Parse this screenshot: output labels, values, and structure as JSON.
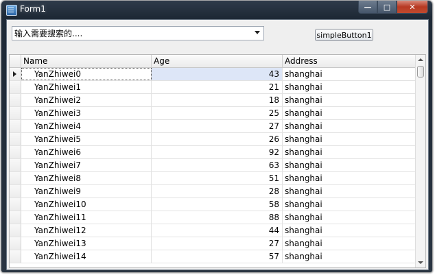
{
  "window": {
    "title": "Form1",
    "icon": "app-form-icon",
    "controls": [
      "minimize-icon",
      "maximize-icon",
      "close-icon"
    ]
  },
  "search": {
    "value": "输入需要搜索的....",
    "icon": "chevron-down-icon"
  },
  "button": {
    "label": "simpleButton1"
  },
  "grid": {
    "columns": [
      "Name",
      "Age",
      "Address"
    ],
    "rows": [
      {
        "name": "YanZhiwei0",
        "age": "43",
        "address": "shanghai"
      },
      {
        "name": "YanZhiwei1",
        "age": "21",
        "address": "shanghai"
      },
      {
        "name": "YanZhiwei2",
        "age": "18",
        "address": "shanghai"
      },
      {
        "name": "YanZhiwei3",
        "age": "25",
        "address": "shanghai"
      },
      {
        "name": "YanZhiwei4",
        "age": "27",
        "address": "shanghai"
      },
      {
        "name": "YanZhiwei5",
        "age": "26",
        "address": "shanghai"
      },
      {
        "name": "YanZhiwei6",
        "age": "92",
        "address": "shanghai"
      },
      {
        "name": "YanZhiwei7",
        "age": "63",
        "address": "shanghai"
      },
      {
        "name": "YanZhiwei8",
        "age": "51",
        "address": "shanghai"
      },
      {
        "name": "YanZhiwei9",
        "age": "28",
        "address": "shanghai"
      },
      {
        "name": "YanZhiwei10",
        "age": "58",
        "address": "shanghai"
      },
      {
        "name": "YanZhiwei11",
        "age": "88",
        "address": "shanghai"
      },
      {
        "name": "YanZhiwei12",
        "age": "44",
        "address": "shanghai"
      },
      {
        "name": "YanZhiwei13",
        "age": "27",
        "address": "shanghai"
      },
      {
        "name": "YanZhiwei14",
        "age": "57",
        "address": "shanghai"
      }
    ],
    "focused_row": 0
  },
  "colors": {
    "titlebar": "#1e2936",
    "close_button": "#c24a2f",
    "focused_row": "#e3ebf9"
  }
}
